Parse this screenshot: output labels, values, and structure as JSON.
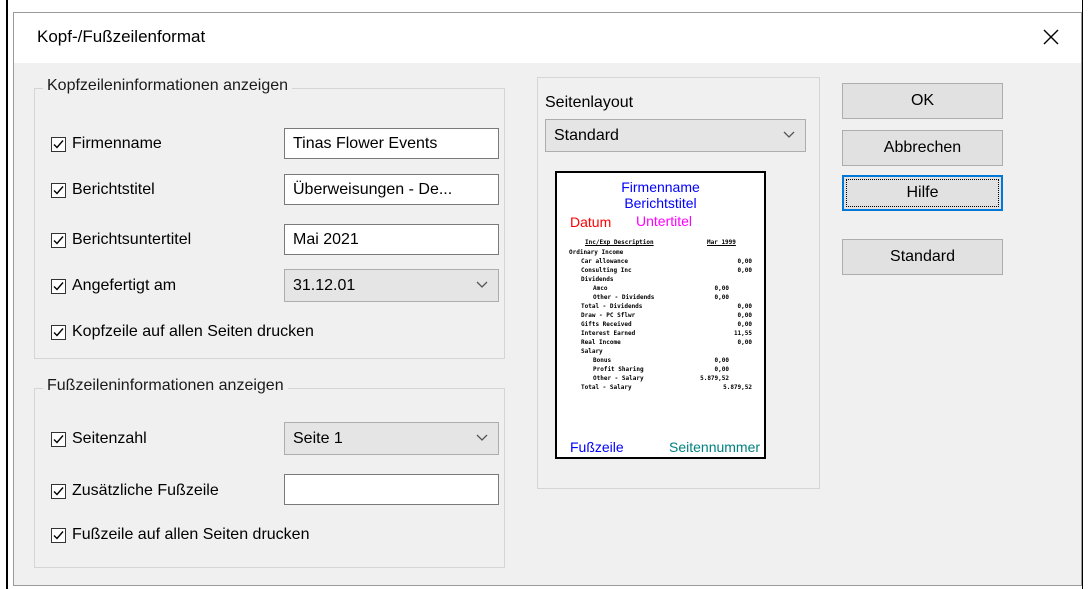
{
  "dialog": {
    "title": "Kopf-/Fußzeilenformat"
  },
  "header_group": {
    "legend": "Kopfzeileninformationen anzeigen",
    "company_name": {
      "label": "Firmenname",
      "checked": true,
      "value": "Tinas Flower Events"
    },
    "report_title": {
      "label": "Berichtstitel",
      "checked": true,
      "value": "Überweisungen - De..."
    },
    "report_subtitle": {
      "label": "Berichtsuntertitel",
      "checked": true,
      "value": "Mai 2021"
    },
    "prepared_on": {
      "label": "Angefertigt am",
      "checked": true,
      "value": "31.12.01"
    },
    "print_header_all_pages": {
      "label": "Kopfzeile auf allen Seiten drucken",
      "checked": true
    }
  },
  "footer_group": {
    "legend": "Fußzeileninformationen anzeigen",
    "page_number": {
      "label": "Seitenzahl",
      "checked": true,
      "value": "Seite 1"
    },
    "extra_footer": {
      "label": "Zusätzliche Fußzeile",
      "checked": true,
      "value": ""
    },
    "print_footer_all_pages": {
      "label": "Fußzeile auf allen Seiten drucken",
      "checked": true
    }
  },
  "layout": {
    "label": "Seitenlayout",
    "selected": "Standard",
    "preview": {
      "company": "Firmenname",
      "title": "Berichtstitel",
      "date": "Datum",
      "subtitle": "Untertitel",
      "footer": "Fußzeile",
      "page_number": "Seitennummer",
      "colors": {
        "company": "#0000ff",
        "date": "#ff0000",
        "subtitle": "#ff00ff",
        "footer": "#0000ff",
        "page_number": "#008080"
      },
      "report_header_left": "Inc/Exp Description",
      "report_header_right": "Mar 1999",
      "rows": [
        {
          "label": "Ordinary Income",
          "indent": 0,
          "a": "",
          "b": ""
        },
        {
          "label": "Car allowance",
          "indent": 2,
          "a": "",
          "b": "0,00"
        },
        {
          "label": "Consulting Inc",
          "indent": 2,
          "a": "",
          "b": "0,00"
        },
        {
          "label": "Dividends",
          "indent": 2,
          "a": "",
          "b": ""
        },
        {
          "label": "Amco",
          "indent": 4,
          "a": "0,00",
          "b": ""
        },
        {
          "label": "Other - Dividends",
          "indent": 4,
          "a": "0,00",
          "b": ""
        },
        {
          "label": "Total - Dividends",
          "indent": 2,
          "a": "",
          "b": "0,00"
        },
        {
          "label": "Draw - PC Sflwr",
          "indent": 2,
          "a": "",
          "b": "0,00"
        },
        {
          "label": "Gifts Received",
          "indent": 2,
          "a": "",
          "b": "0,00"
        },
        {
          "label": "Interest Earned",
          "indent": 2,
          "a": "",
          "b": "11,55"
        },
        {
          "label": "Real Income",
          "indent": 2,
          "a": "",
          "b": "0,00"
        },
        {
          "label": "Salary",
          "indent": 2,
          "a": "",
          "b": ""
        },
        {
          "label": "Bonus",
          "indent": 4,
          "a": "0,00",
          "b": ""
        },
        {
          "label": "Profit Sharing",
          "indent": 4,
          "a": "0,00",
          "b": ""
        },
        {
          "label": "Other - Salary",
          "indent": 4,
          "a": "5.879,52",
          "b": ""
        },
        {
          "label": "Total - Salary",
          "indent": 2,
          "a": "",
          "b": "5.879,52"
        }
      ]
    }
  },
  "buttons": {
    "ok": "OK",
    "cancel": "Abbrechen",
    "help": "Hilfe",
    "default": "Standard"
  }
}
